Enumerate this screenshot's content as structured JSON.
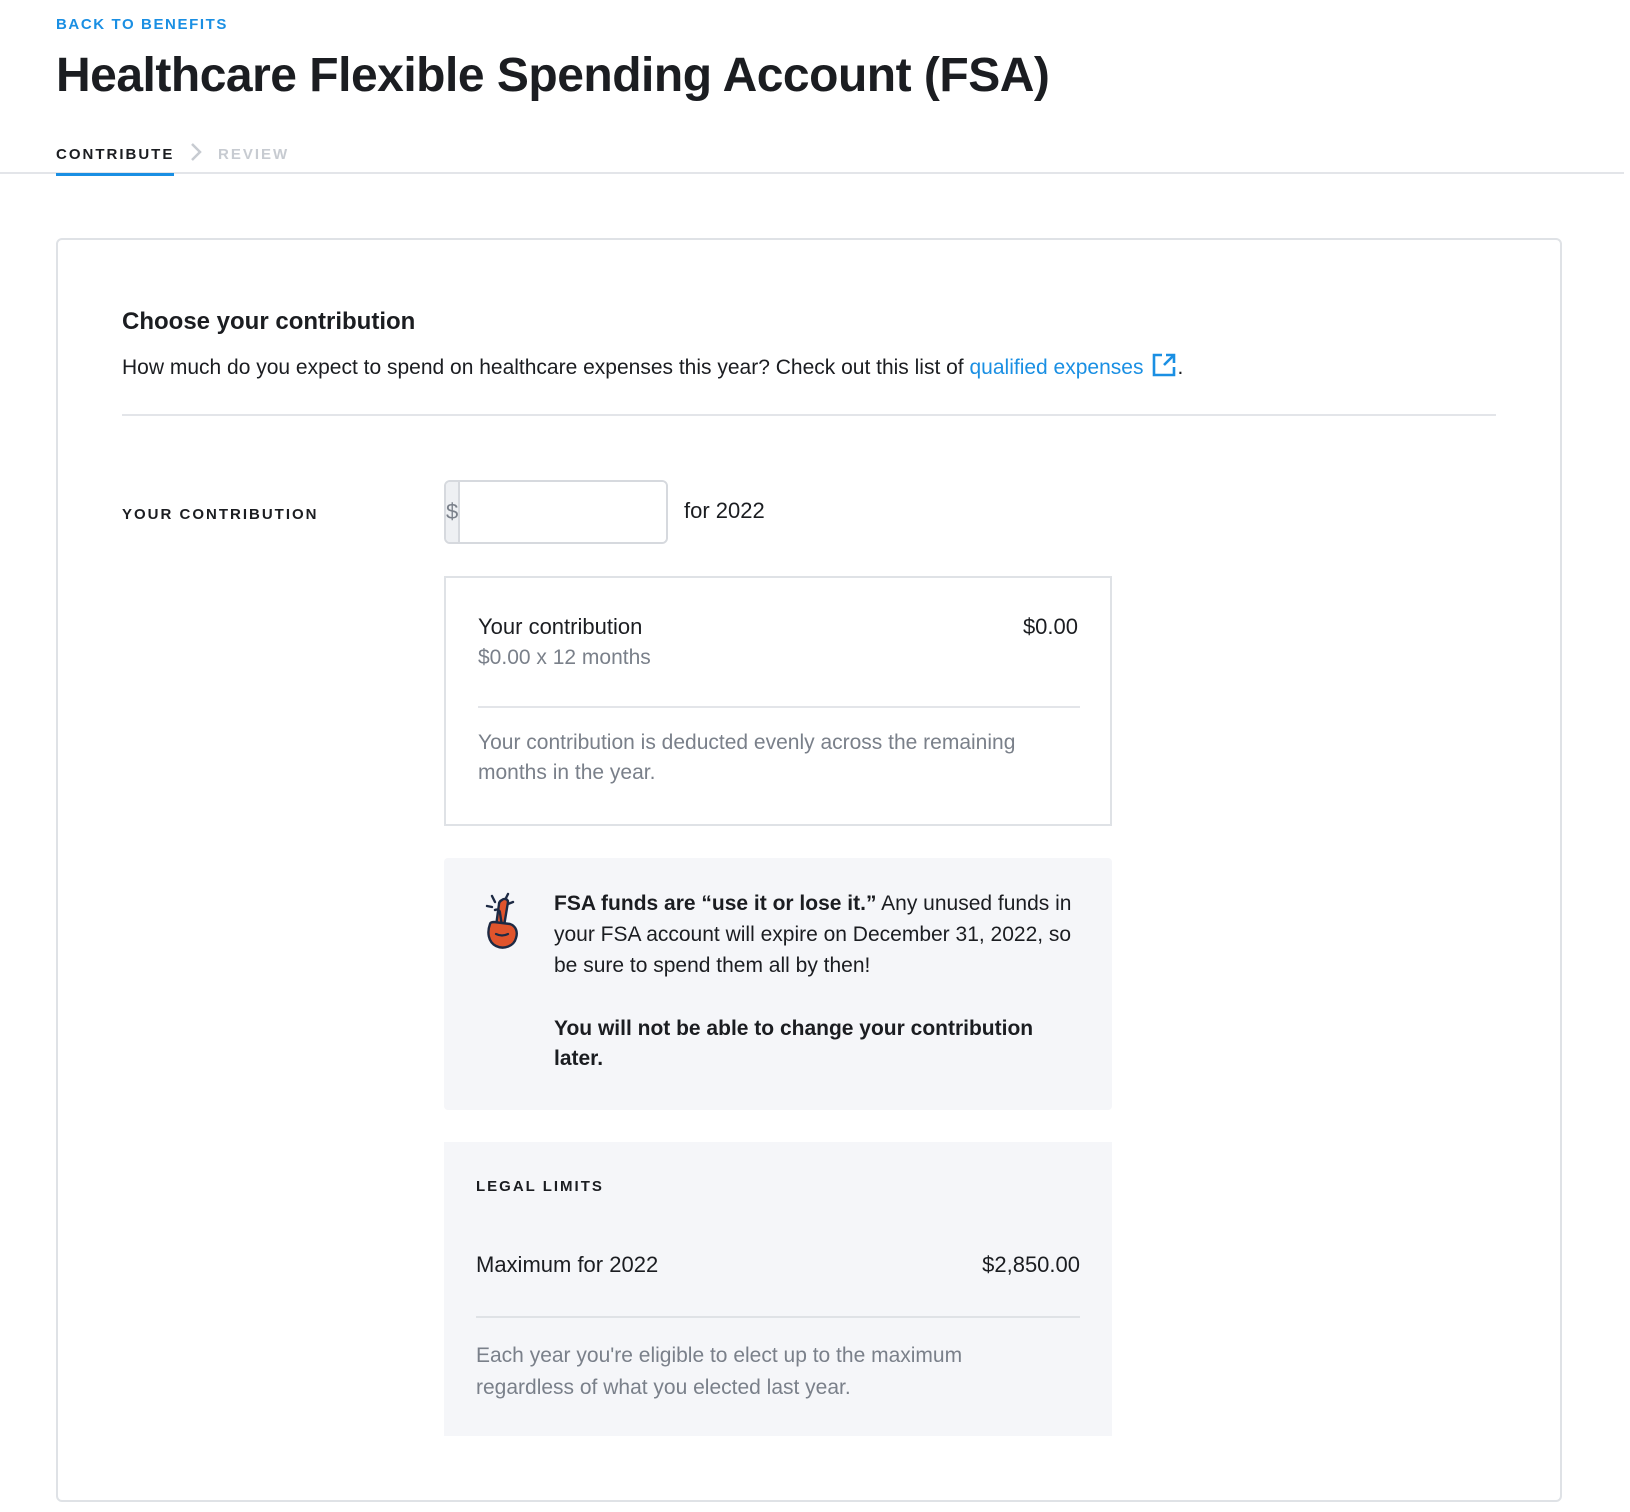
{
  "header": {
    "back_link": "BACK TO BENEFITS",
    "title": "Healthcare Flexible Spending Account (FSA)"
  },
  "steps": {
    "current": "CONTRIBUTE",
    "next": "REVIEW"
  },
  "section": {
    "title": "Choose your contribution",
    "description": "How much do you expect to spend on healthcare expenses this year? Check out this list of",
    "link_text": "qualified expenses",
    "link_suffix": "."
  },
  "contribution": {
    "label": "YOUR CONTRIBUTION",
    "currency_symbol": "$",
    "amount": "0.00",
    "year_suffix": "for 2022"
  },
  "summary": {
    "label": "Your contribution",
    "value": "$0.00",
    "breakdown": "$0.00 x 12 months",
    "note": "Your contribution is deducted evenly across the remaining months in the year."
  },
  "alert": {
    "icon": "fingers-crossed-icon",
    "bold_lead": "FSA funds are “use it or lose it.”",
    "body": "Any unused funds in your FSA account will expire on December 31, 2022, so be sure to spend them all by then!",
    "warning": "You will not be able to change your contribution later."
  },
  "legal_limits": {
    "title": "LEGAL LIMITS",
    "label": "Maximum for 2022",
    "value": "$2,850.00",
    "note": "Each year you're eligible to elect up to the maximum regardless of what you elected last year."
  },
  "colors": {
    "accent": "#1a8fe3",
    "text": "#1b1d21",
    "muted": "#7a808a",
    "panel": "#f5f6f9",
    "icon_orange": "#e0542c",
    "icon_navy": "#1d2a44"
  }
}
